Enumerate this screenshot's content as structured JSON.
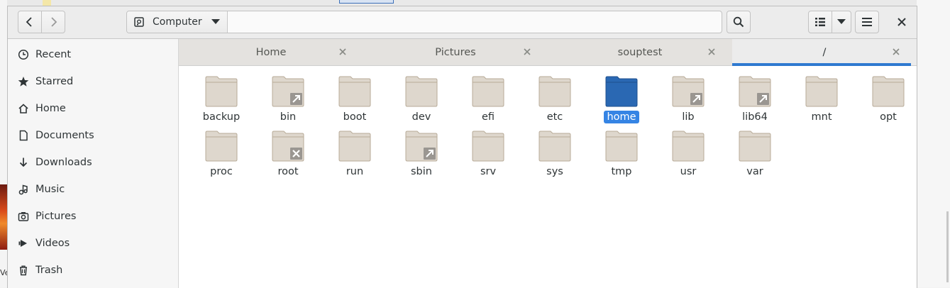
{
  "location": {
    "label": "Computer"
  },
  "sidebar": {
    "items": [
      {
        "label": "Recent",
        "icon": "clock-icon"
      },
      {
        "label": "Starred",
        "icon": "star-icon"
      },
      {
        "label": "Home",
        "icon": "home-icon"
      },
      {
        "label": "Documents",
        "icon": "document-icon"
      },
      {
        "label": "Downloads",
        "icon": "download-icon"
      },
      {
        "label": "Music",
        "icon": "music-icon"
      },
      {
        "label": "Pictures",
        "icon": "camera-icon"
      },
      {
        "label": "Videos",
        "icon": "video-icon"
      },
      {
        "label": "Trash",
        "icon": "trash-icon"
      }
    ]
  },
  "tabs": [
    {
      "label": "Home",
      "active": false
    },
    {
      "label": "Pictures",
      "active": false
    },
    {
      "label": "souptest",
      "active": false
    },
    {
      "label": "/",
      "active": true
    }
  ],
  "folders": [
    {
      "name": "backup",
      "badge": ""
    },
    {
      "name": "bin",
      "badge": "link"
    },
    {
      "name": "boot",
      "badge": ""
    },
    {
      "name": "dev",
      "badge": ""
    },
    {
      "name": "efi",
      "badge": ""
    },
    {
      "name": "etc",
      "badge": ""
    },
    {
      "name": "home",
      "badge": "",
      "selected": true
    },
    {
      "name": "lib",
      "badge": "link"
    },
    {
      "name": "lib64",
      "badge": "link"
    },
    {
      "name": "mnt",
      "badge": ""
    },
    {
      "name": "opt",
      "badge": ""
    },
    {
      "name": "proc",
      "badge": ""
    },
    {
      "name": "root",
      "badge": "locked"
    },
    {
      "name": "run",
      "badge": ""
    },
    {
      "name": "sbin",
      "badge": "link"
    },
    {
      "name": "srv",
      "badge": ""
    },
    {
      "name": "sys",
      "badge": ""
    },
    {
      "name": "tmp",
      "badge": ""
    },
    {
      "name": "usr",
      "badge": ""
    },
    {
      "name": "var",
      "badge": ""
    }
  ],
  "colors": {
    "accent": "#3584e4",
    "folder": "#ded7cd",
    "folder_selected": "#2a68b3",
    "tab_underline": "#2f79d0"
  },
  "background": {
    "fragment_text": "Ve"
  }
}
